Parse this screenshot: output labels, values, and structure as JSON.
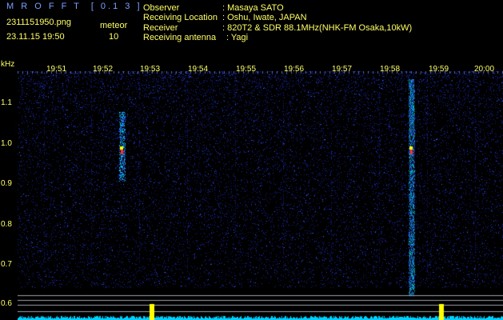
{
  "header": {
    "app_title": "M R O F F T  [ 0.1 3 ]",
    "file_name": "2311151950.png",
    "datetime": "23.11.15 19:50",
    "meteor_label": "meteor",
    "meteor_count": "10",
    "observer_label": "Observer",
    "observer_value": ": Masaya SATO",
    "location_label": "Receiving Location",
    "location_value": ": Oshu, Iwate, JAPAN",
    "receiver_label": "Receiver",
    "receiver_value": ": 820T2 & SDR 88.1MHz(NHK-FM Osaka,10kW)",
    "antenna_label": "Receiving antenna",
    "antenna_value": ": Yagi"
  },
  "axis": {
    "y_unit": "kHz",
    "y_ticks": [
      "1.1",
      "1.0",
      "0.9",
      "0.8",
      "0.7",
      "0.6"
    ],
    "x_ticks": [
      "19:51",
      "19:52",
      "19:53",
      "19:54",
      "19:55",
      "19:56",
      "19:57",
      "19:58",
      "19:59",
      "20:00"
    ]
  },
  "colors": {
    "label": "#ffff66",
    "title": "#7aa0ff",
    "noise": "#1a2a9a",
    "signal": "#00e6ff",
    "hot": "#ff3030",
    "yellow_peak": "#ffff00"
  },
  "chart_data": {
    "type": "heatmap",
    "xlabel": "",
    "ylabel": "kHz",
    "x_range": [
      "19:50",
      "20:00"
    ],
    "y_range": [
      0.59,
      1.2
    ],
    "meteor_traces": [
      {
        "time": "19:53",
        "freq_range": [
          0.93,
          1.1
        ],
        "intensity": "strong"
      },
      {
        "time": "19:59",
        "freq_range": [
          0.65,
          1.18
        ],
        "intensity": "strong"
      }
    ]
  }
}
